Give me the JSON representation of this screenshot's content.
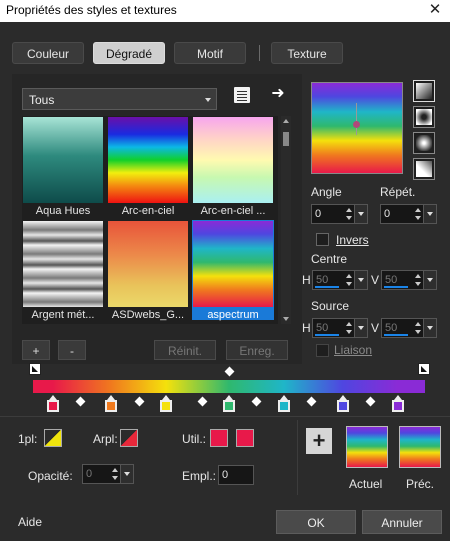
{
  "window": {
    "title": "Propriétés des styles et textures",
    "close": "✕"
  },
  "tabs": [
    {
      "label": "Couleur",
      "active": false
    },
    {
      "label": "Dégradé",
      "active": true
    },
    {
      "label": "Motif",
      "active": false
    },
    {
      "label": "Texture",
      "active": false
    }
  ],
  "category": {
    "value": "Tous"
  },
  "gradients": [
    {
      "label": "Aqua Hues"
    },
    {
      "label": "Arc-en-ciel"
    },
    {
      "label": "Arc-en-ciel ..."
    },
    {
      "label": "Argent mét..."
    },
    {
      "label": "ASDwebs_G..."
    },
    {
      "label": "aspectrum",
      "selected": true
    }
  ],
  "list_buttons": {
    "add": "+",
    "remove": "-",
    "reset": "Réinit.",
    "save": "Enreg."
  },
  "angle": {
    "label": "Angle",
    "value": "0"
  },
  "repeat": {
    "label": "Répét.",
    "value": "0"
  },
  "invert": {
    "label": "Invers",
    "checked": false
  },
  "centre": {
    "label": "Centre",
    "h_label": "H",
    "h_value": "50",
    "v_label": "V",
    "v_value": "50"
  },
  "source": {
    "label": "Source",
    "h_label": "H",
    "h_value": "50",
    "v_label": "V",
    "v_value": "50"
  },
  "link": {
    "label": "Liaison",
    "checked": false
  },
  "stops": {
    "colors": [
      "#e8194a",
      "#f07a1e",
      "#f4e10c",
      "#2fb86e",
      "#1fb6c8",
      "#4f46e0",
      "#8a2bd6"
    ],
    "positions": [
      0.05,
      0.2,
      0.34,
      0.5,
      0.64,
      0.79,
      0.93
    ],
    "midpoints": [
      0.12,
      0.27,
      0.43,
      0.57,
      0.71,
      0.86
    ],
    "midpoint_top": 0.5
  },
  "color_fields": {
    "first_label": "1pl:",
    "arpl_label": "Arpl:",
    "util_label": "Util.:",
    "opacity_label": "Opacité:",
    "opacity_value": "0",
    "empl_label": "Empl.:",
    "empl_value": "0",
    "util_color": "#e8194a"
  },
  "previews": {
    "current_label": "Actuel",
    "previous_label": "Préc."
  },
  "footer": {
    "help": "Aide",
    "ok": "OK",
    "cancel": "Annuler"
  },
  "colors": {
    "accent": "#1a7ad8",
    "background": "#2b2b2b"
  }
}
